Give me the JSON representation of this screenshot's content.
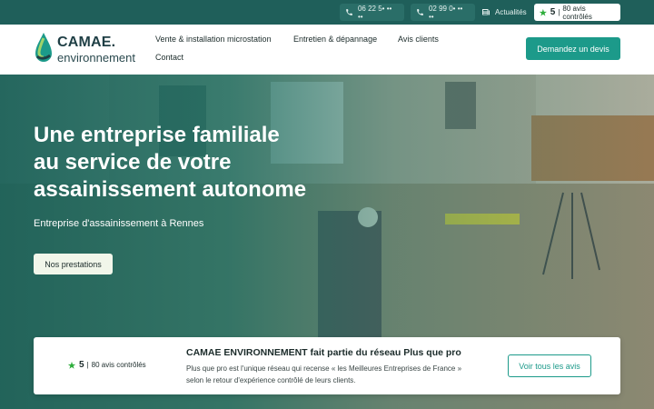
{
  "topbar": {
    "phone1": "06 22 5• •• ••",
    "phone2": "02 99 0• •• ••",
    "news_label": "Actualités",
    "rating": {
      "score": "5",
      "count": "80 avis contrôlés"
    }
  },
  "header": {
    "logo_name": "CAMAE.",
    "logo_sub": "environnement",
    "nav": [
      "Vente & installation microstation",
      "Entretien & dépannage",
      "Avis clients",
      "Contact"
    ],
    "cta_label": "Demandez un devis"
  },
  "hero": {
    "title_lines": [
      "Une entreprise familiale",
      "au service de votre",
      "assainissement autonome"
    ],
    "subtitle": "Entreprise d'assainissement à Rennes",
    "button_label": "Nos prestations"
  },
  "review_card": {
    "rating": {
      "score": "5",
      "count": "80 avis contrôlés"
    },
    "title": "CAMAE ENVIRONNEMENT fait partie du réseau Plus que pro",
    "text": "Plus que pro est l'unique réseau qui recense « les Meilleures Entreprises de France » selon le retour d'expérience contrôlé de leurs clients.",
    "button_label": "Voir tous les avis"
  },
  "colors": {
    "topbar": "#1f5f5a",
    "accent": "#1c9a8a",
    "star": "#2fae3c"
  }
}
